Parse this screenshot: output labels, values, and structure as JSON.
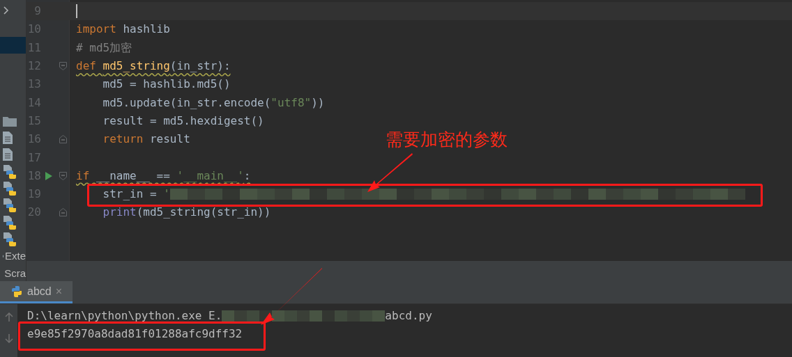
{
  "sidebar": {
    "items": [
      {
        "kind": "expand",
        "selected": false
      },
      {
        "kind": "row",
        "selected": true
      },
      {
        "kind": "folder",
        "selected": false
      },
      {
        "kind": "file",
        "selected": false
      },
      {
        "kind": "file",
        "selected": false
      },
      {
        "kind": "python",
        "selected": false
      },
      {
        "kind": "python",
        "selected": false
      },
      {
        "kind": "python",
        "selected": false
      },
      {
        "kind": "python",
        "selected": false
      },
      {
        "kind": "python",
        "selected": false
      },
      {
        "kind": "libraries",
        "selected": false,
        "label": "Exte"
      },
      {
        "kind": "scratches",
        "selected": false,
        "label": "Scra"
      }
    ]
  },
  "editor": {
    "lines": [
      {
        "number": "9",
        "current": true,
        "run": false,
        "fold_open": false,
        "fold_close": false,
        "warning": false
      },
      {
        "number": "10",
        "current": false,
        "run": false,
        "fold_open": false,
        "fold_close": false,
        "warning": false,
        "tokens": [
          {
            "kind": "keyword",
            "text": "import"
          },
          {
            "kind": "plain",
            "text": " hashlib"
          }
        ]
      },
      {
        "number": "11",
        "current": false,
        "run": false,
        "fold_open": false,
        "fold_close": false,
        "warning": false,
        "tokens": [
          {
            "kind": "comment",
            "text": "# md5加密"
          }
        ]
      },
      {
        "number": "12",
        "current": false,
        "run": false,
        "fold_open": true,
        "fold_close": false,
        "warning": true,
        "tokens": [
          {
            "kind": "keyword",
            "text": "def "
          },
          {
            "kind": "function",
            "text": "md5_string"
          },
          {
            "kind": "plain",
            "text": "(in_str):"
          }
        ]
      },
      {
        "number": "13",
        "current": false,
        "run": false,
        "fold_open": false,
        "fold_close": false,
        "warning": false,
        "tokens": [
          {
            "kind": "plain",
            "text": "    md5 = hashlib.md5()"
          }
        ]
      },
      {
        "number": "14",
        "current": false,
        "run": false,
        "fold_open": false,
        "fold_close": false,
        "warning": false,
        "tokens": [
          {
            "kind": "plain",
            "text": "    md5.update(in_str.encode("
          },
          {
            "kind": "string",
            "text": "\"utf8\""
          },
          {
            "kind": "plain",
            "text": "))"
          }
        ]
      },
      {
        "number": "15",
        "current": false,
        "run": false,
        "fold_open": false,
        "fold_close": false,
        "warning": false,
        "tokens": [
          {
            "kind": "plain",
            "text": "    result = md5.hexdigest()"
          }
        ]
      },
      {
        "number": "16",
        "current": false,
        "run": false,
        "fold_open": false,
        "fold_close": true,
        "warning": false,
        "tokens": [
          {
            "kind": "keyword",
            "text": "    return"
          },
          {
            "kind": "plain",
            "text": " result"
          }
        ]
      },
      {
        "number": "17",
        "current": false,
        "run": false,
        "fold_open": false,
        "fold_close": false,
        "warning": false
      },
      {
        "number": "18",
        "current": false,
        "run": true,
        "fold_open": true,
        "fold_close": false,
        "warning": true,
        "tokens": [
          {
            "kind": "keyword",
            "text": "if"
          },
          {
            "kind": "plain",
            "text": " __name__ == "
          },
          {
            "kind": "string",
            "text": "'__main__'"
          },
          {
            "kind": "plain",
            "text": ":"
          }
        ]
      },
      {
        "number": "19",
        "current": false,
        "run": false,
        "fold_open": false,
        "fold_close": false,
        "warning": false,
        "tokens": [
          {
            "kind": "plain",
            "text": "    str_in = "
          },
          {
            "kind": "string",
            "text": "'"
          },
          {
            "kind": "redacted"
          }
        ]
      },
      {
        "number": "20",
        "current": false,
        "run": false,
        "fold_open": false,
        "fold_close": true,
        "warning": false,
        "tokens": [
          {
            "kind": "builtin",
            "text": "    print"
          },
          {
            "kind": "plain",
            "text": "(md5_string(str_in))"
          }
        ]
      }
    ]
  },
  "annotation": {
    "text": "需要加密的参数"
  },
  "run_panel": {
    "tabs": [
      {
        "label": "abcd",
        "selected": true,
        "close": "×"
      }
    ],
    "console": [
      {
        "parts": [
          {
            "kind": "text",
            "text": "D:\\learn\\python\\python.exe E."
          },
          {
            "kind": "redacted"
          },
          {
            "kind": "text",
            "text": "abcd.py"
          }
        ]
      },
      {
        "parts": [
          {
            "kind": "text",
            "text": "e9e85f2970a8dad81f01288afc9dff32"
          }
        ]
      }
    ]
  }
}
